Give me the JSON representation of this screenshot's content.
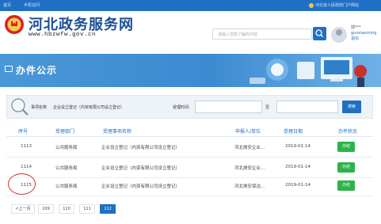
{
  "topbar": {
    "home_label": "首页",
    "mobile_label": "手机访问",
    "user_label": "河北省人民政府门户网站"
  },
  "header": {
    "site_title": "河北政务服务网",
    "site_url": "www.hbzwfw.gov.cn",
    "search_placeholder": "请输入您想了解的内容",
    "user_name": "郭***",
    "user_account": "guoxiaoming",
    "logout_label": "退出"
  },
  "banner": {
    "title": "办件公示"
  },
  "filter": {
    "dept_label": "事项名称",
    "item_value": "企业设立登记（内资有限公司设立登记）",
    "date_label": "受理时间:",
    "date_to": "至",
    "search_button": "搜索"
  },
  "table": {
    "headers": [
      "序号",
      "受理部门",
      "受理事项名称",
      "申报人/单位",
      "受理日期",
      "办件状态"
    ],
    "rows": [
      {
        "seq": "1113",
        "dept": "公共服务局",
        "name": "企业设立登记（内资有限公司设立登记）",
        "applicant": "河北晟安企业...",
        "date": "2019-01-14",
        "status": "办结"
      },
      {
        "seq": "1114",
        "dept": "公共服务局",
        "name": "企业设立登记（内资有限公司设立登记）",
        "applicant": "河北晟安企业...",
        "date": "2019-01-14",
        "status": "办结"
      },
      {
        "seq": "1115",
        "dept": "公共服务局",
        "name": "企业设立登记（内资有限公司设立登记）",
        "applicant": "河北晟安保洁...",
        "date": "2019-01-14",
        "status": "办结"
      }
    ]
  },
  "pager": {
    "prev_label": "<上一页",
    "pages": [
      "109",
      "110",
      "111",
      "112"
    ],
    "active_page": "112"
  },
  "colors": {
    "primary": "#1f6fc5",
    "status_green": "#2db34a",
    "highlight_red": "#c8322b"
  }
}
